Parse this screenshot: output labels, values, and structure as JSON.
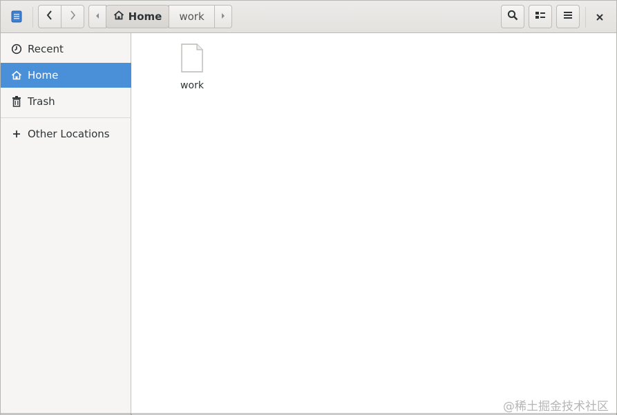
{
  "header": {
    "path": {
      "home_label": "Home",
      "current_label": "work"
    }
  },
  "sidebar": {
    "items": [
      {
        "label": "Recent",
        "icon": "recent-icon"
      },
      {
        "label": "Home",
        "icon": "home-icon",
        "selected": true
      },
      {
        "label": "Trash",
        "icon": "trash-icon"
      },
      {
        "label": "Other Locations",
        "icon": "plus-icon"
      }
    ]
  },
  "content": {
    "files": [
      {
        "name": "work",
        "icon": "document-icon"
      }
    ]
  },
  "watermark": "@稀土掘金技术社区",
  "colors": {
    "selection": "#4a90d9",
    "sidebar_bg": "#f6f5f4",
    "header_bg": "#e8e6e3"
  }
}
